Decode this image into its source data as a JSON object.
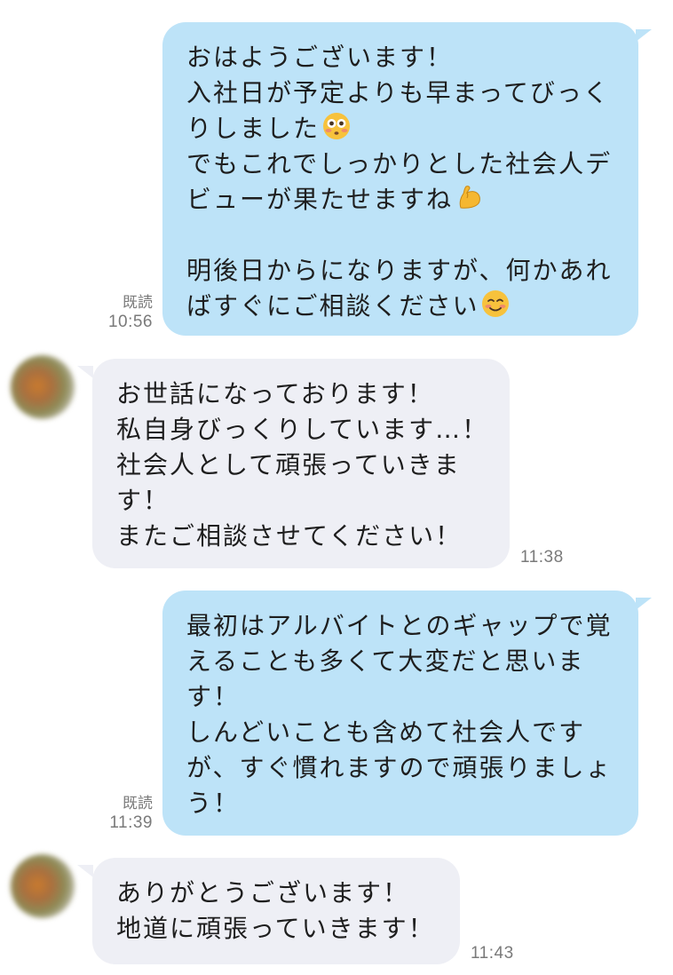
{
  "messages": [
    {
      "id": "m1",
      "direction": "out",
      "read_label": "既読",
      "time": "10:56",
      "lines": [
        {
          "text": "おはようございます！"
        },
        {
          "text": "入社日が予定よりも早まってびっく"
        },
        {
          "text": "りしました",
          "emoji": "flushed-face-emoji"
        },
        {
          "text": "でもこれでしっかりとした社会人デ"
        },
        {
          "text": "ビューが果たせますね",
          "emoji": "flexed-biceps-emoji"
        },
        {
          "text": ""
        },
        {
          "text": "明後日からになりますが、何かあれ"
        },
        {
          "text": "ばすぐにご相談ください",
          "emoji": "smiling-face-emoji"
        }
      ]
    },
    {
      "id": "m2",
      "direction": "in",
      "time": "11:38",
      "lines": [
        {
          "text": "お世話になっております！"
        },
        {
          "text": "私自身びっくりしています…！"
        },
        {
          "text": "社会人として頑張っていきま"
        },
        {
          "text": "す！"
        },
        {
          "text": "またご相談させてください！"
        }
      ]
    },
    {
      "id": "m3",
      "direction": "out",
      "read_label": "既読",
      "time": "11:39",
      "lines": [
        {
          "text": "最初はアルバイトとのギャップで覚"
        },
        {
          "text": "えることも多くて大変だと思いま"
        },
        {
          "text": "す！"
        },
        {
          "text": "しんどいことも含めて社会人です"
        },
        {
          "text": "が、すぐ慣れますので頑張りましょ"
        },
        {
          "text": "う！"
        }
      ]
    },
    {
      "id": "m4",
      "direction": "in",
      "time": "11:43",
      "lines": [
        {
          "text": "ありがとうございます！"
        },
        {
          "text": "地道に頑張っていきます！"
        }
      ]
    }
  ],
  "colors": {
    "outgoing_bubble": "#bde3f8",
    "incoming_bubble": "#eeeff5",
    "meta_text": "#7a7a7a"
  }
}
